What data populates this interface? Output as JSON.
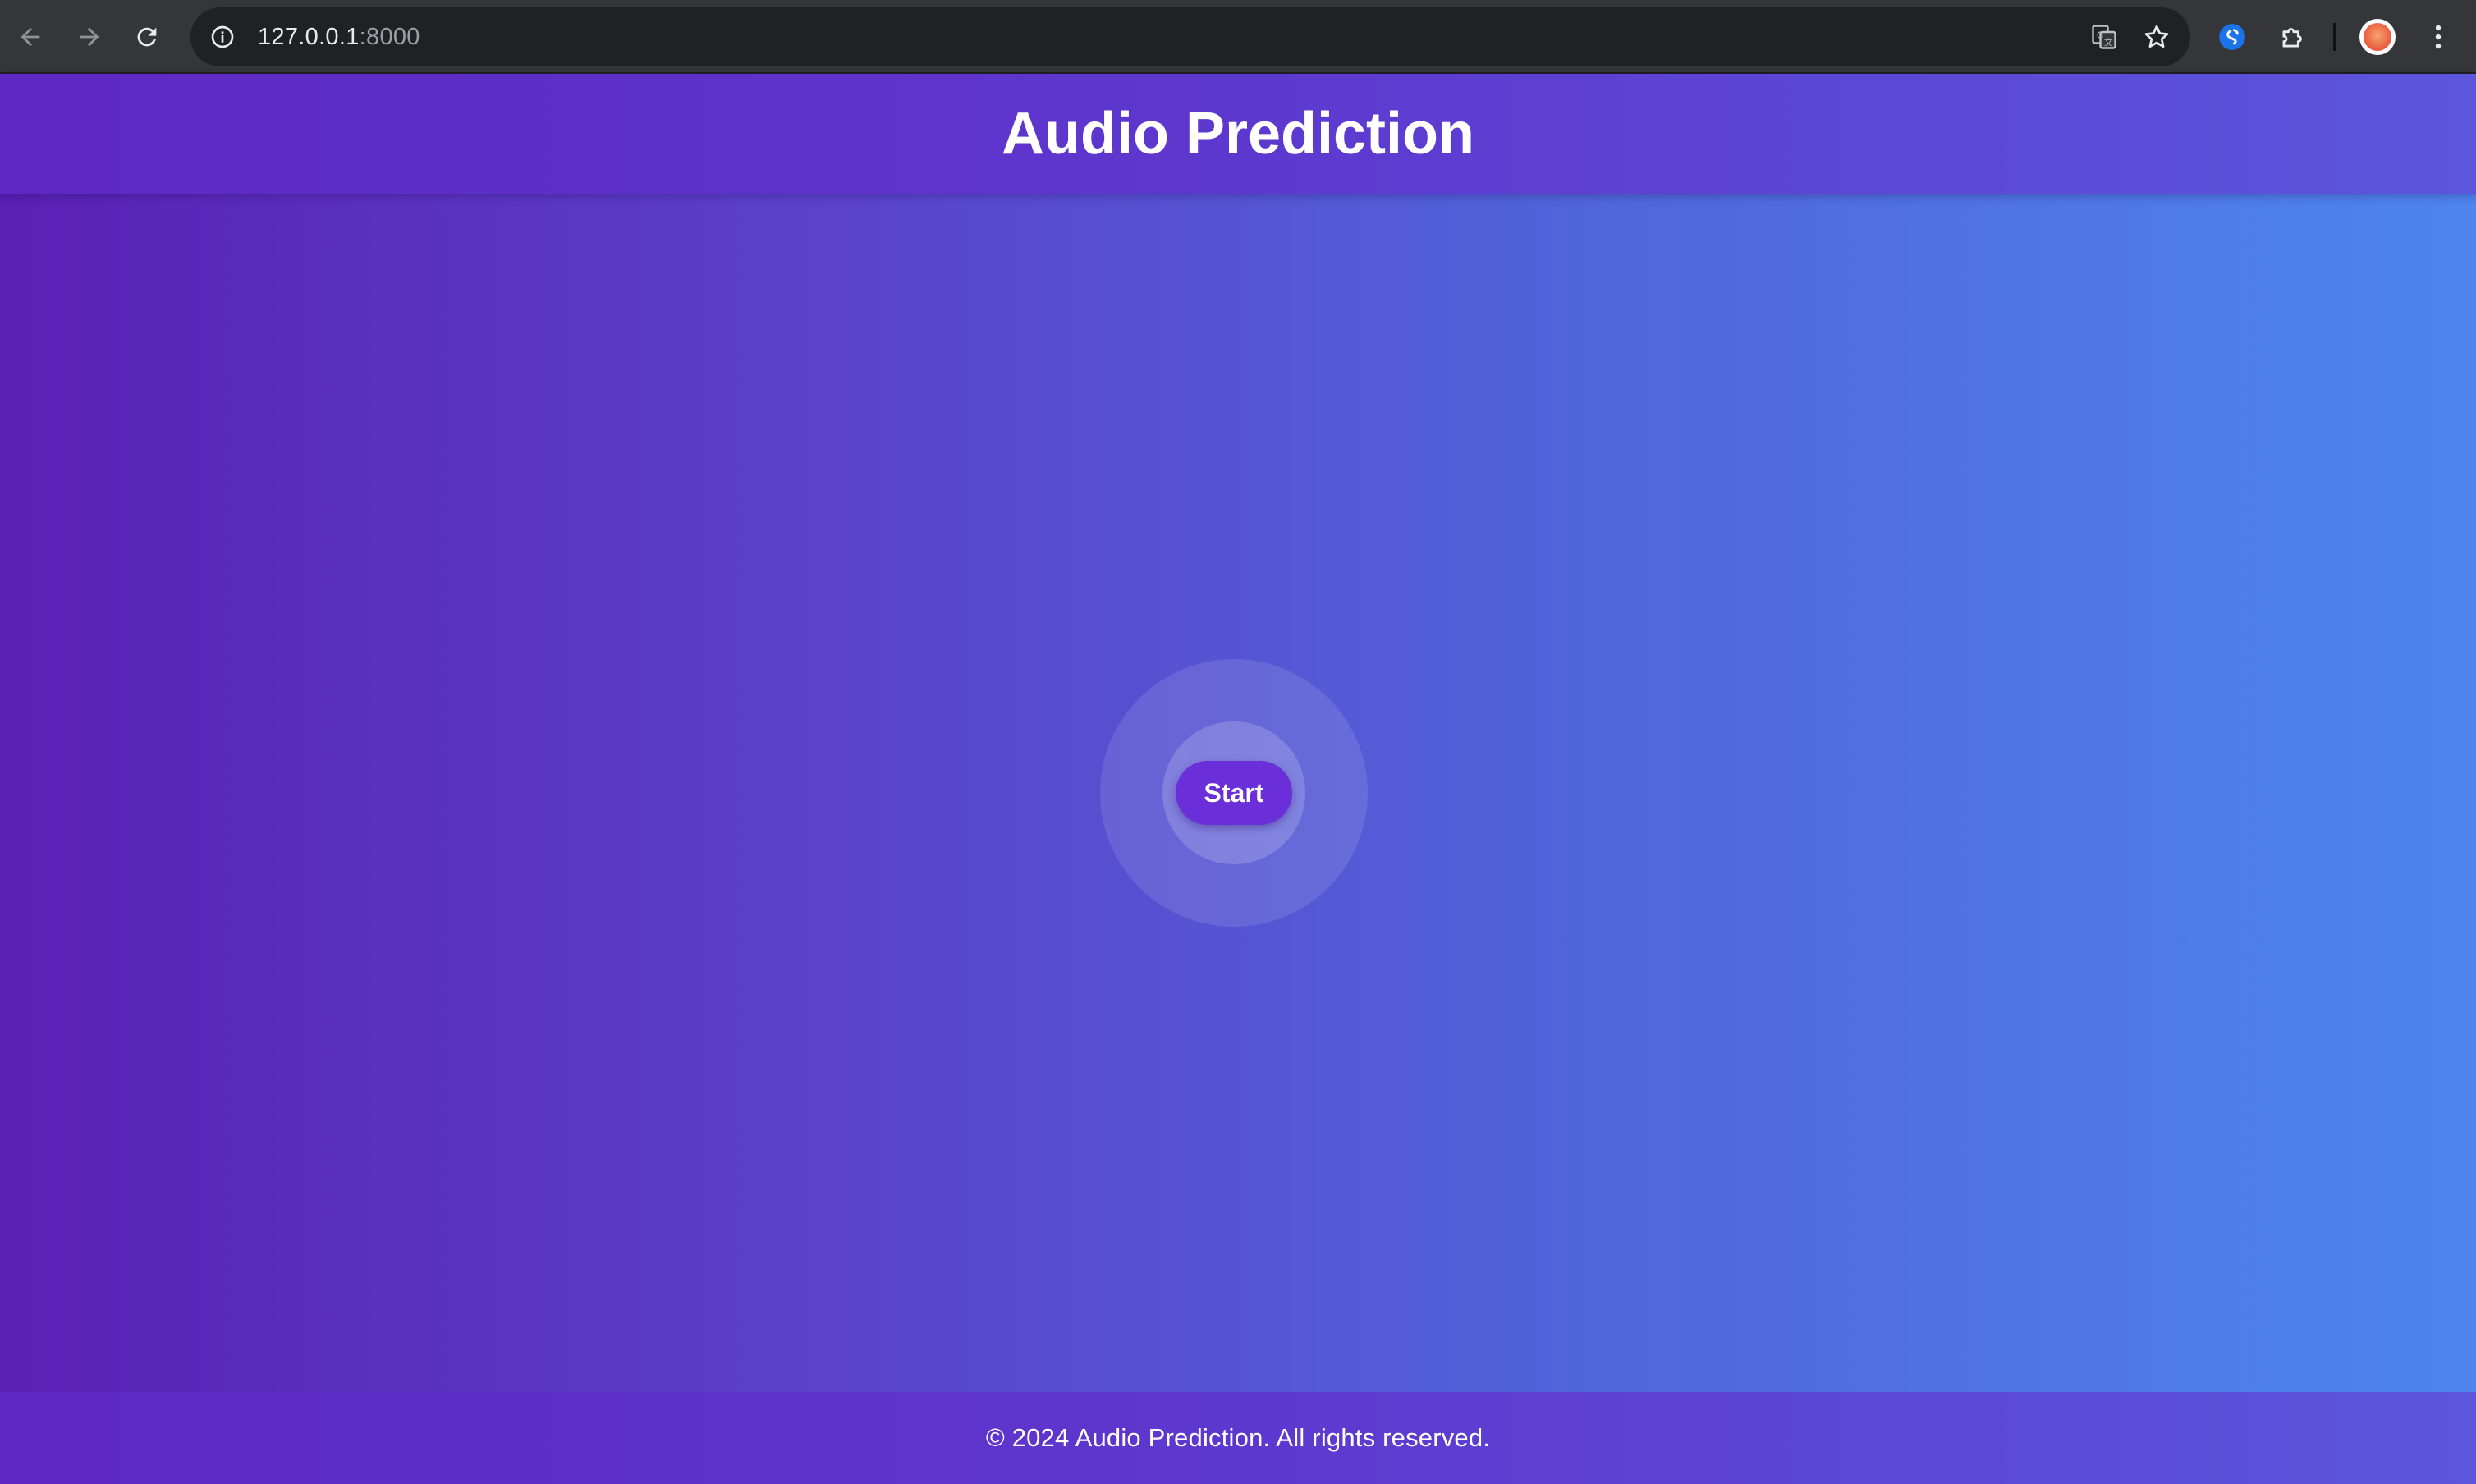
{
  "browser": {
    "url_host": "127.0.0.1",
    "url_port": ":8000",
    "icons": {
      "back": "back-arrow-icon",
      "forward": "forward-arrow-icon",
      "reload": "reload-icon",
      "site_info": "info-icon",
      "translate": "translate-icon",
      "bookmark": "star-icon",
      "extension_app": "shazam-icon",
      "extensions": "puzzle-icon",
      "profile": "avatar",
      "menu": "kebab-menu-icon"
    }
  },
  "header": {
    "title": "Audio Prediction"
  },
  "main": {
    "start_label": "Start"
  },
  "footer": {
    "text": "© 2024 Audio Prediction. All rights reserved."
  },
  "colors": {
    "header_bg": "#5d38cf",
    "page_gradient_start": "#5a20b4",
    "page_gradient_end": "#4e85ee",
    "button_bg": "#6a2fd9",
    "text": "#ffffff"
  }
}
